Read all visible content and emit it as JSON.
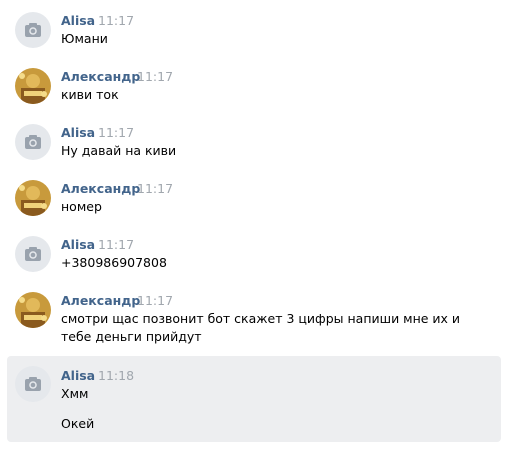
{
  "messages": [
    {
      "author": "Alisa",
      "time": "11:17",
      "avatar": "camera-placeholder-icon",
      "lines": [
        "Юмани"
      ]
    },
    {
      "author": "Александр",
      "time": "11:17",
      "avatar": "user-photo",
      "lines": [
        "киви ток"
      ]
    },
    {
      "author": "Alisa",
      "time": "11:17",
      "avatar": "camera-placeholder-icon",
      "lines": [
        "Ну давай на киви"
      ]
    },
    {
      "author": "Александр",
      "time": "11:17",
      "avatar": "user-photo",
      "lines": [
        "номер"
      ]
    },
    {
      "author": "Alisa",
      "time": "11:17",
      "avatar": "camera-placeholder-icon",
      "lines": [
        "+380986907808"
      ]
    },
    {
      "author": "Александр",
      "time": "11:17",
      "avatar": "user-photo",
      "lines": [
        "смотри щас позвонит бот скажет 3 цифры напиши мне их и",
        "тебе деньги прийдут"
      ]
    },
    {
      "author": "Alisa",
      "time": "11:18",
      "avatar": "camera-placeholder-icon",
      "lines": [
        "Хмм",
        "Окей"
      ]
    }
  ],
  "colors": {
    "author": "#42648b",
    "time": "#a1a7ae",
    "text": "#000000",
    "highlight_bg": "#edeef0",
    "avatar_placeholder": "#e5e8ec"
  }
}
